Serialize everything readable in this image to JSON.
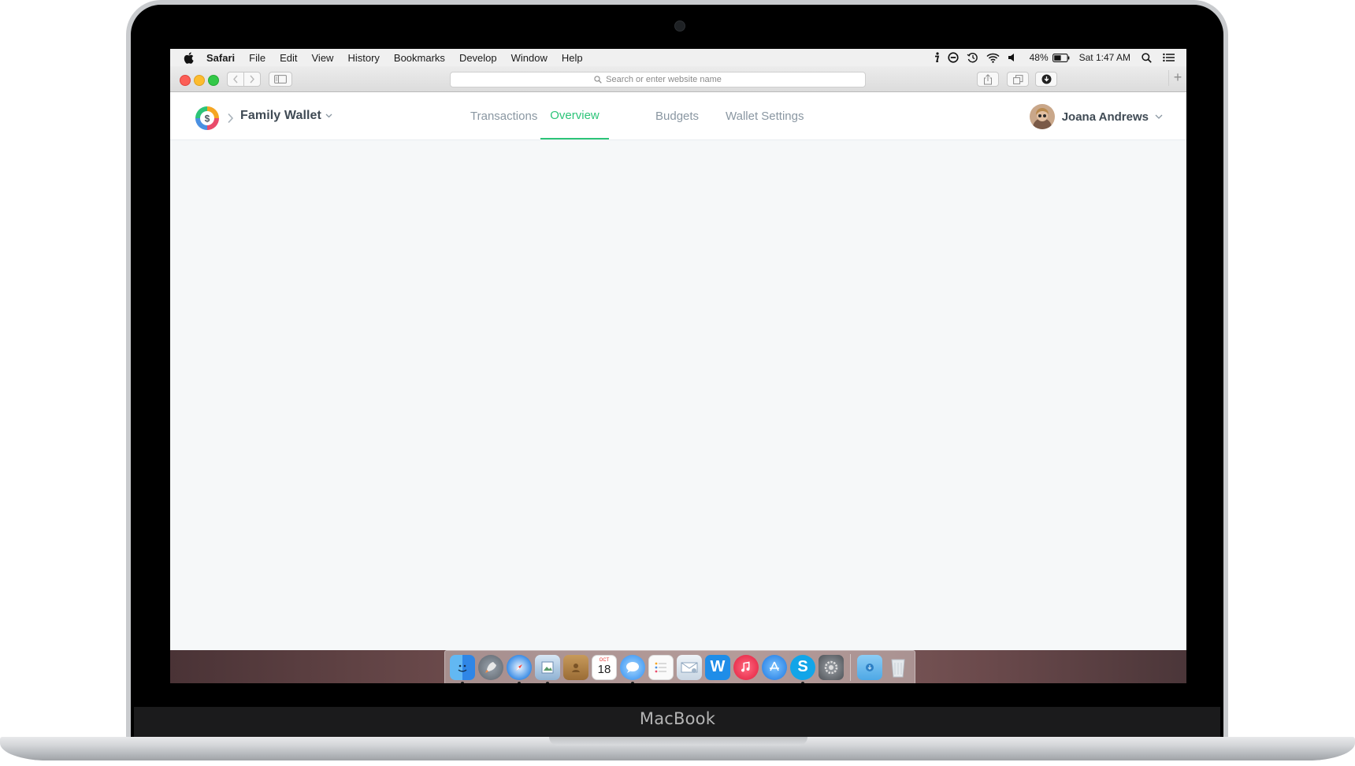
{
  "device": {
    "brand_label": "MacBook"
  },
  "menubar": {
    "app_name": "Safari",
    "items": [
      "File",
      "Edit",
      "View",
      "History",
      "Bookmarks",
      "Develop",
      "Window",
      "Help"
    ],
    "battery": "48%",
    "clock": "Sat 1:47 AM",
    "status_icons": [
      "info-icon",
      "do-not-disturb-icon",
      "time-machine-icon",
      "wifi-icon",
      "volume-icon",
      "battery-icon",
      "spotlight-icon",
      "notification-center-icon"
    ]
  },
  "browser": {
    "address_placeholder": "Search or enter website name"
  },
  "app": {
    "wallet_name": "Family Wallet",
    "nav_tabs": [
      {
        "label": "Transactions",
        "active": false
      },
      {
        "label": "Overview",
        "active": true
      },
      {
        "label": "Budgets",
        "active": false
      },
      {
        "label": "Wallet Settings",
        "active": false
      }
    ],
    "user_name": "Joana Andrews",
    "accent_color": "#2cc478"
  },
  "dock": {
    "apps": [
      "finder-icon",
      "launchpad-icon",
      "safari-icon",
      "preview-icon",
      "contacts-icon",
      "calendar-icon",
      "messages-icon",
      "reminders-icon",
      "mail-icon",
      "word-icon",
      "itunes-icon",
      "app-store-icon",
      "skype-icon",
      "system-preferences-icon",
      "downloads-folder-icon",
      "trash-icon"
    ],
    "calendar_month": "OCT",
    "calendar_day": "18",
    "skype_letter": "S",
    "word_letter": "W"
  }
}
